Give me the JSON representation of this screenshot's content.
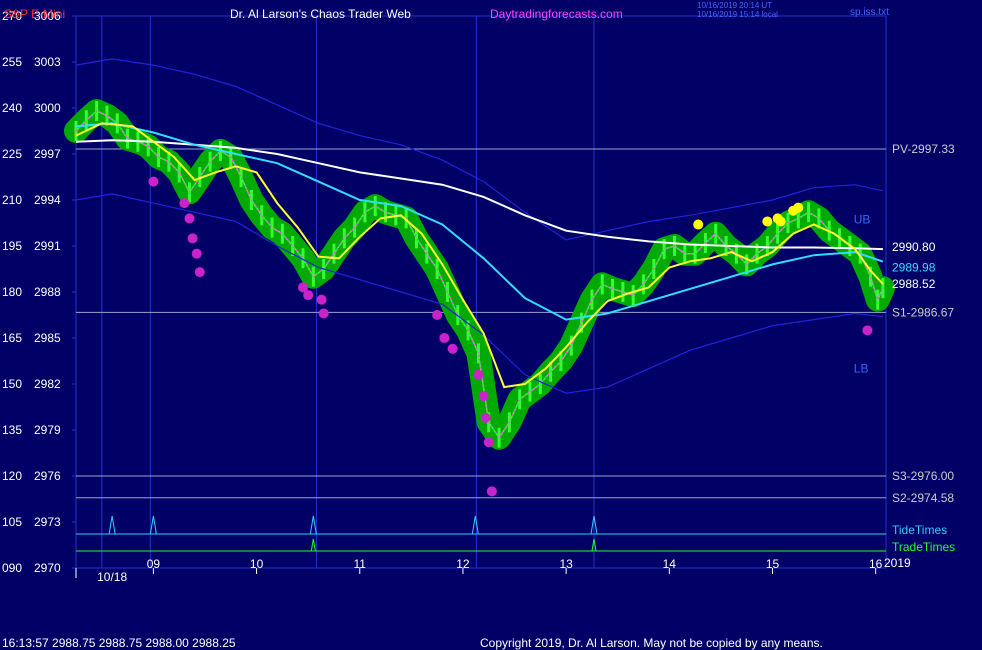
{
  "header": {
    "title_left": "S&P E-Mini",
    "title_center": "Dr. Al Larson's Chaos Trader Web",
    "title_site": "Daytradingforecasts.com",
    "stamp_line1": "10/16/2019 20:14 UT",
    "stamp_line2": "10/16/2019 15:14 local",
    "file_name": "sp.iss.txt"
  },
  "footer": {
    "quote": "16:13:57  2988.75 2988.75 2988.00 2988.25",
    "copyright": "Copyright 2019, Dr. Al Larson. May not be copied by any means."
  },
  "colors": {
    "background": "#000066",
    "grid": "#2233cc",
    "axis_text": "#ffffff",
    "price_band": "#2222dd",
    "white_ma": "#ffffff",
    "cyan_ma": "#33ddff",
    "yellow_ma": "#ffff33",
    "magenta_ma": "#ff44ff",
    "halo": "#00aa00",
    "bars": "#33ff33",
    "dots_magenta": "#cc22cc",
    "dots_yellow": "#ffff00",
    "tide": "#33ccff",
    "trade": "#22ff22"
  },
  "chart_data": {
    "type": "line",
    "y_axis": {
      "price_ticks": [
        3006,
        3003,
        3000,
        2997,
        2994,
        2991,
        2988,
        2985,
        2982,
        2979,
        2976,
        2973,
        2970
      ],
      "index_ticks": [
        "270",
        "255",
        "240",
        "225",
        "210",
        "195",
        "180",
        "165",
        "150",
        "135",
        "120",
        "105",
        "090"
      ],
      "ylim": [
        2970,
        3006
      ]
    },
    "x_axis": {
      "hour_labels": [
        "09",
        "10",
        "11",
        "12",
        "13",
        "14",
        "15",
        "16"
      ],
      "date_label": "10/18",
      "year_label": "2019",
      "xlim": [
        8.25,
        16.1
      ]
    },
    "reference_lines": [
      {
        "label": "PV-2997.33",
        "value": 2997.33
      },
      {
        "label": "S1-2986.67",
        "value": 2986.67
      },
      {
        "label": "S3-2976.00",
        "value": 2976.0
      },
      {
        "label": "S2-2974.58",
        "value": 2974.58
      }
    ],
    "end_labels": [
      {
        "label": "2990.80",
        "value": 2990.8
      },
      {
        "label": "2989.98",
        "value": 2989.98
      },
      {
        "label": "2988.52",
        "value": 2988.52
      }
    ],
    "band_labels": {
      "upper": "UB",
      "lower": "LB"
    },
    "vertical_markers": [
      8.5,
      8.97,
      10.58,
      12.13,
      13.27
    ],
    "tide_times": [
      8.6,
      9.0,
      10.55,
      12.12,
      13.27
    ],
    "trade_times": [
      10.55,
      13.27
    ],
    "tide_label": "TideTimes",
    "trade_label": "TradeTimes",
    "series": [
      {
        "key": "price",
        "x": [
          8.25,
          8.35,
          8.45,
          8.55,
          8.65,
          8.75,
          8.85,
          8.95,
          9.05,
          9.15,
          9.25,
          9.35,
          9.45,
          9.55,
          9.65,
          9.75,
          9.85,
          9.95,
          10.05,
          10.15,
          10.25,
          10.35,
          10.45,
          10.55,
          10.65,
          10.75,
          10.85,
          10.95,
          11.05,
          11.15,
          11.25,
          11.35,
          11.45,
          11.55,
          11.65,
          11.75,
          11.85,
          11.95,
          12.05,
          12.15,
          12.25,
          12.35,
          12.45,
          12.55,
          12.65,
          12.75,
          12.85,
          12.95,
          13.05,
          13.15,
          13.25,
          13.35,
          13.45,
          13.55,
          13.65,
          13.75,
          13.85,
          13.95,
          14.05,
          14.15,
          14.25,
          14.35,
          14.45,
          14.55,
          14.65,
          14.75,
          14.85,
          14.95,
          15.05,
          15.15,
          15.25,
          15.35,
          15.45,
          15.55,
          15.65,
          15.75,
          15.85,
          15.95,
          16.02,
          16.07
        ],
        "y": [
          2998.5,
          2999.2,
          2999.8,
          2999.5,
          2999.0,
          2998.0,
          2997.8,
          2997.5,
          2996.8,
          2996.5,
          2995.8,
          2994.5,
          2995.5,
          2996.5,
          2997.2,
          2996.8,
          2995.5,
          2994.0,
          2993.0,
          2992.2,
          2991.8,
          2991.0,
          2990.2,
          2989.0,
          2989.5,
          2990.5,
          2991.5,
          2992.2,
          2993.2,
          2993.6,
          2993.2,
          2993.0,
          2992.8,
          2991.5,
          2990.5,
          2989.5,
          2988.0,
          2986.5,
          2985.5,
          2984.0,
          2979.5,
          2978.5,
          2979.5,
          2981.0,
          2981.5,
          2982.0,
          2982.8,
          2983.5,
          2984.5,
          2986.0,
          2987.5,
          2988.5,
          2988.2,
          2988.0,
          2987.8,
          2988.5,
          2989.5,
          2990.8,
          2991.0,
          2990.5,
          2990.5,
          2991.2,
          2991.8,
          2991.0,
          2990.5,
          2989.8,
          2990.5,
          2991.0,
          2991.8,
          2992.5,
          2992.8,
          2993.2,
          2992.8,
          2992.0,
          2991.5,
          2991.0,
          2990.5,
          2989.0,
          2987.5,
          2988.25
        ]
      },
      {
        "key": "yellow",
        "x": [
          8.25,
          8.5,
          8.8,
          9.0,
          9.2,
          9.4,
          9.6,
          9.8,
          10.0,
          10.2,
          10.4,
          10.6,
          10.8,
          11.0,
          11.2,
          11.4,
          11.6,
          11.8,
          12.0,
          12.2,
          12.4,
          12.6,
          12.8,
          13.0,
          13.2,
          13.4,
          13.6,
          13.8,
          14.0,
          14.2,
          14.4,
          14.6,
          14.8,
          15.0,
          15.2,
          15.4,
          15.6,
          15.8,
          15.95,
          16.07
        ],
        "y": [
          2998.2,
          2999.0,
          2998.8,
          2997.8,
          2996.8,
          2995.3,
          2995.8,
          2996.2,
          2995.8,
          2993.8,
          2992.2,
          2990.3,
          2990.2,
          2991.6,
          2992.8,
          2993.0,
          2991.8,
          2989.8,
          2987.5,
          2985.3,
          2981.8,
          2982.0,
          2983.0,
          2984.4,
          2986.0,
          2987.4,
          2987.9,
          2988.3,
          2989.6,
          2990.0,
          2990.2,
          2990.6,
          2990.0,
          2990.6,
          2991.8,
          2992.4,
          2991.8,
          2990.8,
          2989.4,
          2988.52
        ]
      },
      {
        "key": "cyan",
        "x": [
          8.25,
          8.6,
          9.0,
          9.4,
          9.8,
          10.2,
          10.6,
          11.0,
          11.4,
          11.8,
          12.2,
          12.6,
          13.0,
          13.4,
          13.8,
          14.2,
          14.6,
          15.0,
          15.4,
          15.8,
          16.07
        ],
        "y": [
          2998.8,
          2999.0,
          2998.4,
          2997.6,
          2997.0,
          2996.4,
          2995.2,
          2994.0,
          2993.6,
          2992.4,
          2990.2,
          2987.6,
          2986.2,
          2986.6,
          2987.4,
          2988.2,
          2989.0,
          2989.8,
          2990.4,
          2990.6,
          2989.98
        ]
      },
      {
        "key": "white",
        "x": [
          8.25,
          8.6,
          9.0,
          9.4,
          9.8,
          10.2,
          10.6,
          11.0,
          11.4,
          11.8,
          12.2,
          12.6,
          13.0,
          13.4,
          13.8,
          14.2,
          14.6,
          15.0,
          15.4,
          15.8,
          16.07
        ],
        "y": [
          2997.8,
          2997.9,
          2997.8,
          2997.6,
          2997.4,
          2997.0,
          2996.4,
          2995.8,
          2995.4,
          2995.0,
          2994.2,
          2993.0,
          2992.0,
          2991.6,
          2991.3,
          2991.1,
          2991.0,
          2990.9,
          2990.9,
          2990.85,
          2990.8
        ]
      },
      {
        "key": "upper_band",
        "x": [
          8.25,
          8.6,
          9.0,
          9.4,
          9.8,
          10.2,
          10.6,
          11.0,
          11.4,
          11.8,
          12.2,
          12.6,
          13.0,
          13.4,
          13.8,
          14.2,
          14.6,
          15.0,
          15.4,
          15.8,
          16.07
        ],
        "y": [
          3002.8,
          3003.2,
          3002.8,
          3002.2,
          3001.4,
          3000.2,
          2999.0,
          2998.2,
          2997.6,
          2996.6,
          2995.2,
          2993.2,
          2991.4,
          2992.0,
          2992.6,
          2993.0,
          2993.5,
          2994.0,
          2994.8,
          2995.0,
          2994.6
        ]
      },
      {
        "key": "lower_band",
        "x": [
          8.25,
          8.6,
          9.0,
          9.4,
          9.8,
          10.2,
          10.6,
          11.0,
          11.4,
          11.8,
          12.2,
          12.6,
          13.0,
          13.4,
          13.8,
          14.2,
          14.6,
          15.0,
          15.4,
          15.8,
          16.07
        ],
        "y": [
          2994.0,
          2994.4,
          2993.8,
          2993.2,
          2992.6,
          2991.0,
          2989.6,
          2988.8,
          2988.0,
          2987.2,
          2985.2,
          2982.6,
          2981.4,
          2981.8,
          2983.0,
          2984.2,
          2985.0,
          2985.8,
          2986.2,
          2986.6,
          2986.4
        ]
      }
    ],
    "magenta_dots": [
      {
        "x": 9.0,
        "y": 2995.2
      },
      {
        "x": 9.3,
        "y": 2993.8
      },
      {
        "x": 9.35,
        "y": 2992.8
      },
      {
        "x": 9.38,
        "y": 2991.5
      },
      {
        "x": 9.42,
        "y": 2990.5
      },
      {
        "x": 9.45,
        "y": 2989.3
      },
      {
        "x": 10.45,
        "y": 2988.3
      },
      {
        "x": 10.5,
        "y": 2987.8
      },
      {
        "x": 10.63,
        "y": 2987.5
      },
      {
        "x": 10.65,
        "y": 2986.6
      },
      {
        "x": 11.75,
        "y": 2986.5
      },
      {
        "x": 11.82,
        "y": 2985.0
      },
      {
        "x": 11.9,
        "y": 2984.3
      },
      {
        "x": 12.15,
        "y": 2982.6
      },
      {
        "x": 12.2,
        "y": 2981.2
      },
      {
        "x": 12.22,
        "y": 2979.8
      },
      {
        "x": 12.25,
        "y": 2978.2
      },
      {
        "x": 12.28,
        "y": 2975.0
      },
      {
        "x": 15.92,
        "y": 2985.5
      }
    ],
    "yellow_dots": [
      {
        "x": 14.28,
        "y": 2992.4
      },
      {
        "x": 14.95,
        "y": 2992.6
      },
      {
        "x": 15.05,
        "y": 2992.8
      },
      {
        "x": 15.08,
        "y": 2992.6
      },
      {
        "x": 15.2,
        "y": 2993.3
      },
      {
        "x": 15.25,
        "y": 2993.5
      }
    ]
  }
}
